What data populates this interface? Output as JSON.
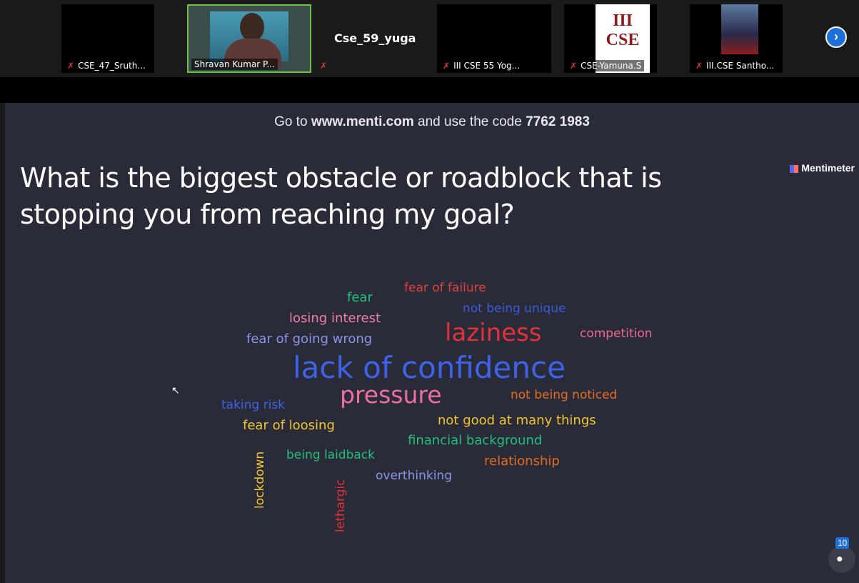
{
  "participants": [
    {
      "name": "CSE_47_Sruth...",
      "muted": true
    },
    {
      "name": "Shravan Kumar P...",
      "muted": false
    },
    {
      "name": "",
      "muted": true
    },
    {
      "name": "Cse_59_yuga",
      "muted": false
    },
    {
      "name": "III CSE 55 Yog...",
      "muted": true
    },
    {
      "name": "CSE-Yamuna.S",
      "muted": true
    },
    {
      "name": "III.CSE Santho...",
      "muted": true
    }
  ],
  "tile_card_text": "III CSE",
  "slide": {
    "code_prefix": "Go to ",
    "url": "www.menti.com",
    "code_mid": " and use the code ",
    "code": "7762 1983",
    "question": "What is the biggest obstacle or roadblock that is stopping you from reaching my goal?",
    "brand": "Mentimeter"
  },
  "wordcloud": [
    {
      "text": "fear of failure",
      "color": "#e0403f"
    },
    {
      "text": "fear",
      "color": "#22c07f"
    },
    {
      "text": "not being unique",
      "color": "#3b5bd9"
    },
    {
      "text": "losing interest",
      "color": "#ef7fa7"
    },
    {
      "text": "laziness",
      "color": "#e2313a"
    },
    {
      "text": "competition",
      "color": "#ef6a8e"
    },
    {
      "text": "fear of going wrong",
      "color": "#8c95ea"
    },
    {
      "text": "lack of confidence",
      "color": "#3e62e8"
    },
    {
      "text": "pressure",
      "color": "#ef6f9f"
    },
    {
      "text": "not being noticed",
      "color": "#e66d1f"
    },
    {
      "text": "taking risk",
      "color": "#3e62e8"
    },
    {
      "text": "not good at many things",
      "color": "#f2c530"
    },
    {
      "text": "fear of loosing",
      "color": "#f2c530"
    },
    {
      "text": "financial background",
      "color": "#22c07f"
    },
    {
      "text": "being laidback",
      "color": "#22c07f"
    },
    {
      "text": "relationship",
      "color": "#e66d1f"
    },
    {
      "text": "overthinking",
      "color": "#8c95ea"
    },
    {
      "text": "lockdown",
      "color": "#f2c530"
    },
    {
      "text": "lethargic",
      "color": "#e2313a"
    }
  ],
  "participants_badge": "10",
  "icons": {
    "muted": "mic-off-icon",
    "next": "chevron-right-icon",
    "people": "person-icon",
    "cursor": "mouse-pointer-icon"
  }
}
